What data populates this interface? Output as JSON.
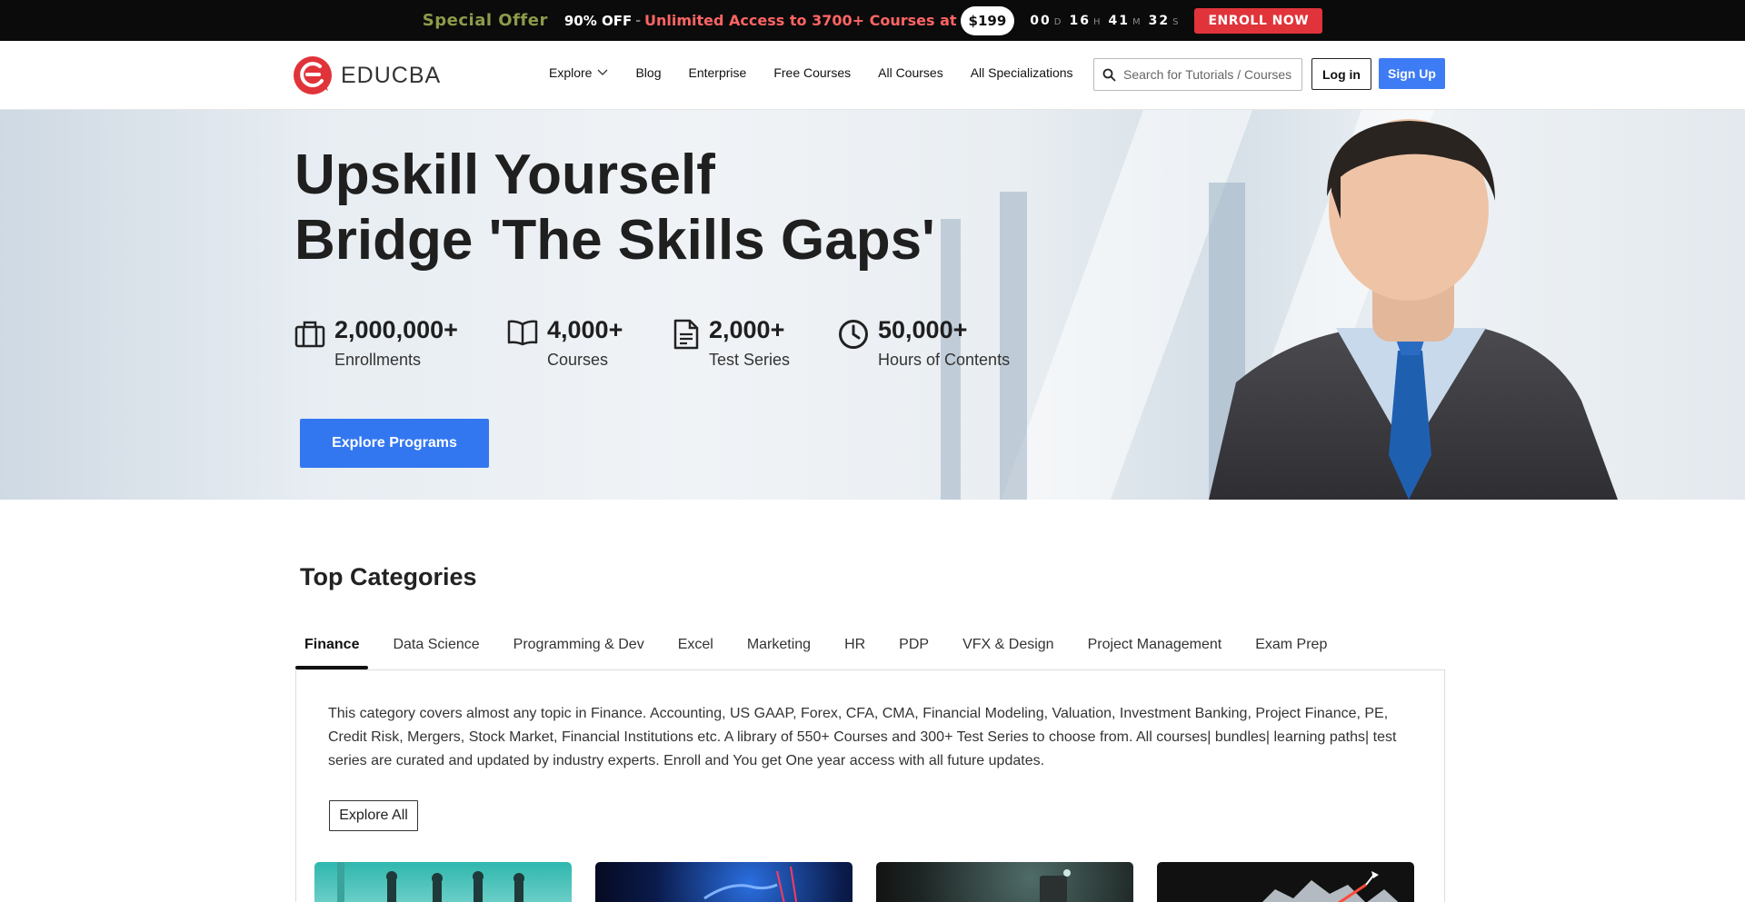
{
  "promo": {
    "special": "Special Offer",
    "off": "90% OFF",
    "dash": "-",
    "unlimited": "Unlimited Access to 3700+ Courses at",
    "price": "$199",
    "timer": [
      {
        "value": "00",
        "unit": "D"
      },
      {
        "value": "16",
        "unit": "H"
      },
      {
        "value": "41",
        "unit": "M"
      },
      {
        "value": "32",
        "unit": "S"
      }
    ],
    "enroll": "ENROLL NOW"
  },
  "header": {
    "logo_text": "EDUCBA",
    "nav": [
      "Explore",
      "Blog",
      "Enterprise",
      "Free Courses",
      "All Courses",
      "All Specializations"
    ],
    "search_placeholder": "Search for Tutorials / Courses",
    "login": "Log in",
    "signup": "Sign Up"
  },
  "hero": {
    "line1": "Upskill Yourself",
    "line2": "Bridge 'The Skills Gaps'",
    "stats": [
      {
        "value": "2,000,000+",
        "label": "Enrollments",
        "icon": "briefcase-icon"
      },
      {
        "value": "4,000+",
        "label": "Courses",
        "icon": "book-icon"
      },
      {
        "value": "2,000+",
        "label": "Test Series",
        "icon": "document-icon"
      },
      {
        "value": "50,000+",
        "label": "Hours of Contents",
        "icon": "clock-icon"
      }
    ],
    "cta": "Explore Programs"
  },
  "categories": {
    "title": "Top Categories",
    "tabs": [
      "Finance",
      "Data Science",
      "Programming & Dev",
      "Excel",
      "Marketing",
      "HR",
      "PDP",
      "VFX & Design",
      "Project Management",
      "Exam Prep"
    ],
    "active_tab": "Finance",
    "description": "This category covers almost any topic in Finance. Accounting, US GAAP, Forex, CFA, CMA, Financial Modeling, Valuation, Investment Banking, Project Finance, PE, Credit Risk, Mergers, Stock Market, Financial Institutions etc. A library of 550+ Courses and 300+ Test Series to choose from. All courses| bundles| learning paths| test series are curated and updated by industry experts. Enroll and You get One year access with all future updates.",
    "explore_all": "Explore All"
  },
  "colors": {
    "brand_red": "#e0343a",
    "primary_blue": "#3377f0",
    "promo_bg": "#0b0b0b"
  }
}
